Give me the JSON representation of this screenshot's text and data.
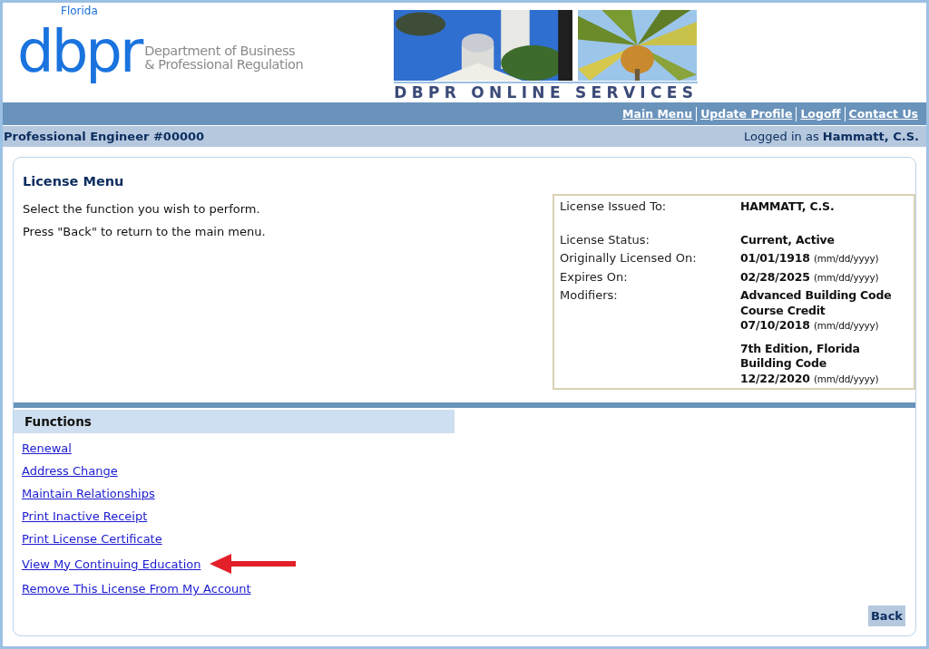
{
  "logo": {
    "state": "Florida",
    "mark": "dbpr",
    "name_line_1": "Department of Business",
    "name_line_2": "& Professional Regulation"
  },
  "banner": {
    "caption": "DBPR ONLINE SERVICES"
  },
  "nav": [
    "Main Menu",
    "Update Profile",
    "Logoff",
    "Contact Us"
  ],
  "account_bar": {
    "license": "Professional Engineer #00000",
    "logged_in_label": "Logged in as",
    "user": "Hammatt, C.S."
  },
  "license_menu": {
    "title": "License Menu",
    "instructions": [
      "Select the function you wish to perform.",
      "Press \"Back\" to return to the main menu."
    ],
    "details": [
      {
        "label": "License Issued To:",
        "values": [
          {
            "text": "HAMMATT, C.S."
          }
        ]
      },
      {
        "label": "License Status:",
        "values": [
          {
            "text": "Current, Active"
          }
        ]
      },
      {
        "label": "Originally Licensed On:",
        "values": [
          {
            "date": "01/01/1918",
            "note": "(mm/dd/yyyy)"
          }
        ]
      },
      {
        "label": "Expires On:",
        "values": [
          {
            "date": "02/28/2025",
            "note": "(mm/dd/yyyy)"
          }
        ]
      },
      {
        "label": "Modifiers:",
        "values": [
          {
            "text": "Advanced Building Code Course Credit",
            "date": "07/10/2018",
            "note": "(mm/dd/yyyy)"
          },
          {
            "text": "7th Edition, Florida Building Code",
            "date": "12/22/2020",
            "note": "(mm/dd/yyyy)"
          }
        ]
      }
    ]
  },
  "functions": {
    "title": "Functions",
    "links": [
      {
        "label": "Renewal",
        "highlighted": false
      },
      {
        "label": "Address Change",
        "highlighted": false
      },
      {
        "label": "Maintain Relationships",
        "highlighted": false
      },
      {
        "label": "Print Inactive Receipt",
        "highlighted": false
      },
      {
        "label": "Print License Certificate",
        "highlighted": false
      },
      {
        "label": "View My Continuing Education",
        "highlighted": true
      },
      {
        "label": "Remove This License From My Account",
        "highlighted": false
      }
    ]
  },
  "back_button": "Back"
}
